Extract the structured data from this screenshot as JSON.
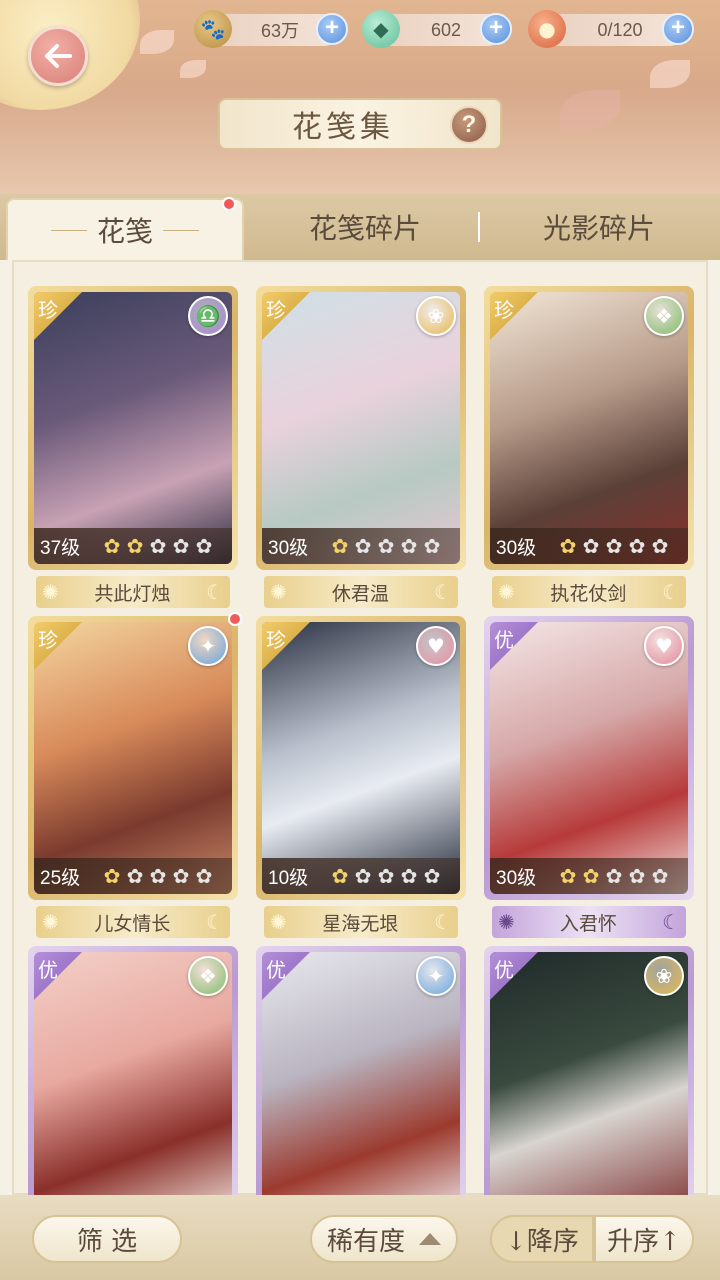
{
  "header": {
    "title": "花笺集",
    "help_label": "?",
    "resources": [
      {
        "icon": "paw-coin-icon",
        "value": "63万"
      },
      {
        "icon": "jade-gem-icon",
        "value": "602"
      },
      {
        "icon": "mooncake-icon",
        "value": "0/120"
      }
    ]
  },
  "tabs": [
    {
      "label": "花笺",
      "active": true,
      "badge": true
    },
    {
      "label": "花笺碎片",
      "active": false
    },
    {
      "label": "光影碎片",
      "active": false
    }
  ],
  "cards": [
    {
      "name": "共此灯烛",
      "level": "37级",
      "stars": 2,
      "rarity": "珍",
      "tier": "gold",
      "badge": "libra-icon",
      "badge_glyph": "♎",
      "badge_color": "#a48ad0"
    },
    {
      "name": "休君温",
      "level": "30级",
      "stars": 1,
      "rarity": "珍",
      "tier": "gold",
      "badge": "lotus-icon",
      "badge_glyph": "❀",
      "badge_color": "#e6b84f"
    },
    {
      "name": "执花仗剑",
      "level": "30级",
      "stars": 1,
      "rarity": "珍",
      "tier": "gold",
      "badge": "leaf-icon",
      "badge_glyph": "❖",
      "badge_color": "#7fbf6a"
    },
    {
      "name": "儿女情长",
      "level": "25级",
      "stars": 1,
      "rarity": "珍",
      "tier": "gold",
      "badge": "flame-icon",
      "badge_glyph": "✦",
      "badge_color": "#6aa6e0",
      "red_dot": true
    },
    {
      "name": "星海无垠",
      "level": "10级",
      "stars": 1,
      "rarity": "珍",
      "tier": "gold",
      "badge": "heart-icon",
      "badge_glyph": "♥",
      "badge_color": "#e58a9a"
    },
    {
      "name": "入君怀",
      "level": "30级",
      "stars": 2,
      "rarity": "优",
      "tier": "purple",
      "badge": "heart-icon",
      "badge_glyph": "♥",
      "badge_color": "#e58a9a"
    },
    {
      "name": "",
      "level": "",
      "stars": 0,
      "rarity": "优",
      "tier": "purple",
      "badge": "leaf-icon",
      "badge_glyph": "❖",
      "badge_color": "#7fbf6a"
    },
    {
      "name": "",
      "level": "",
      "stars": 0,
      "rarity": "优",
      "tier": "purple",
      "badge": "flame-icon",
      "badge_glyph": "✦",
      "badge_color": "#6aa6e0"
    },
    {
      "name": "",
      "level": "",
      "stars": 0,
      "rarity": "优",
      "tier": "purple",
      "badge": "lotus-icon",
      "badge_glyph": "❀",
      "badge_color": "#e6b84f"
    }
  ],
  "bottom": {
    "filter_label": "筛 选",
    "rarity_label": "稀有度",
    "desc_label": "↓降序",
    "asc_label": "升序↑"
  }
}
